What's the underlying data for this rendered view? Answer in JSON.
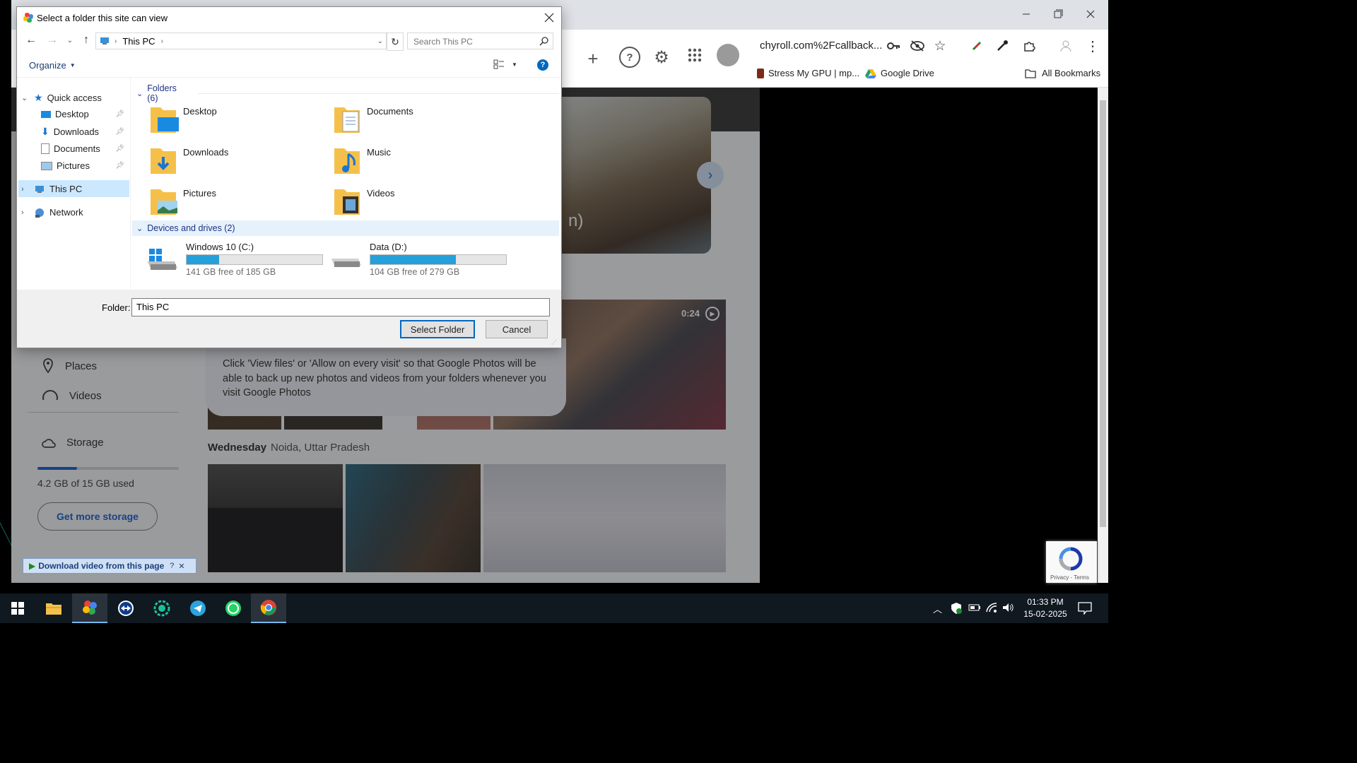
{
  "dialog": {
    "title": "Select a folder this site can view",
    "address_path": "This PC",
    "search_placeholder": "Search This PC",
    "organize_label": "Organize",
    "nav": {
      "quick_access": "Quick access",
      "quick_items": [
        "Desktop",
        "Downloads",
        "Documents",
        "Pictures"
      ],
      "this_pc": "This PC",
      "network": "Network"
    },
    "folders_header": "Folders (6)",
    "folders": [
      "Desktop",
      "Documents",
      "Downloads",
      "Music",
      "Pictures",
      "Videos"
    ],
    "drives_header": "Devices and drives (2)",
    "drives": [
      {
        "name": "Windows 10 (C:)",
        "free_text": "141 GB free of 185 GB",
        "used_fraction": 0.24
      },
      {
        "name": "Data (D:)",
        "free_text": "104 GB free of 279 GB",
        "used_fraction": 0.63
      }
    ],
    "folder_label": "Folder:",
    "folder_value": "This PC",
    "select_button": "Select Folder",
    "cancel_button": "Cancel"
  },
  "browser": {
    "address_text": "chyroll.com%2Fcallback...",
    "bookmarks": [
      "Stress My GPU | mp...",
      "Google Drive"
    ],
    "all_bookmarks": "All Bookmarks"
  },
  "photos": {
    "nav_places": "Places",
    "nav_videos": "Videos",
    "storage_label": "Storage",
    "storage_used": "4.2 GB of 15 GB used",
    "storage_fraction": 0.28,
    "get_more_storage": "Get more storage",
    "day_label": "Wednesday",
    "location_label": "Noida, Uttar Pradesh",
    "video_duration": "0:24",
    "partial_caption": "n)",
    "permission_text": "Click 'View files' or 'Allow on every visit' so that Google Photos will be able to back up new photos and videos from your folders whenever you visit Google Photos",
    "download_bar": "Download video from this page",
    "recaptcha": "Privacy - Terms"
  },
  "taskbar": {
    "time": "01:33 PM",
    "date": "15-02-2025"
  },
  "colors": {
    "accent": "#0067c0",
    "drive_bar": "#26a0da",
    "photos_blue": "#0b57d0"
  }
}
